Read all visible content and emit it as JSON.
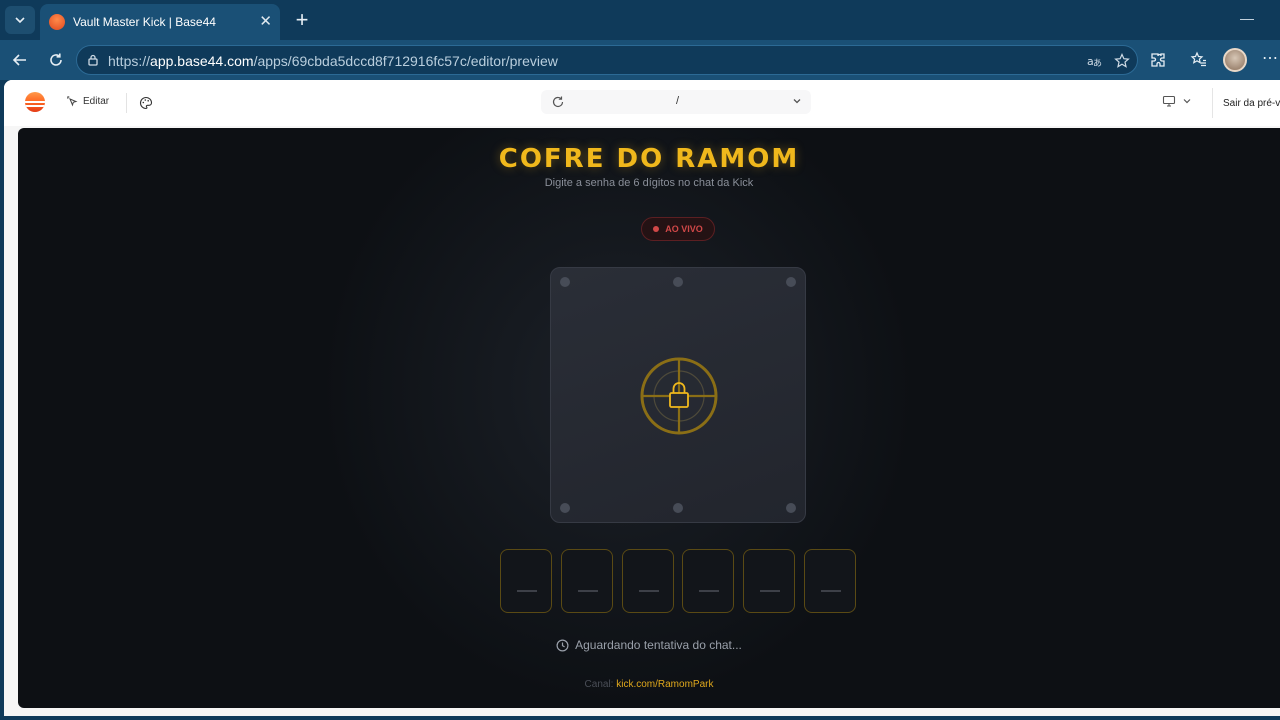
{
  "browser": {
    "tab_title": "Vault Master Kick | Base44",
    "url_prefix": "https://",
    "url_host": "app.base44.com",
    "url_path": "/apps/69cbda5dccd8f712916fc57c/editor/preview"
  },
  "editor": {
    "edit_label": "Editar",
    "route_path": "/",
    "exit_preview_label": "Sair da pré-vi"
  },
  "app": {
    "title": "COFRE DO RAMOM",
    "subtitle": "Digite a senha de 6 dígitos no chat da Kick",
    "live_badge": "AO VIVO",
    "digits": [
      "",
      "",
      "",
      "",
      "",
      ""
    ],
    "status": "Aguardando tentativa do chat...",
    "channel_label": "Canal:",
    "channel_link": "kick.com/RamomPark"
  },
  "colors": {
    "accent": "#f0b81c",
    "live": "#d04848",
    "background": "#0d1014"
  }
}
